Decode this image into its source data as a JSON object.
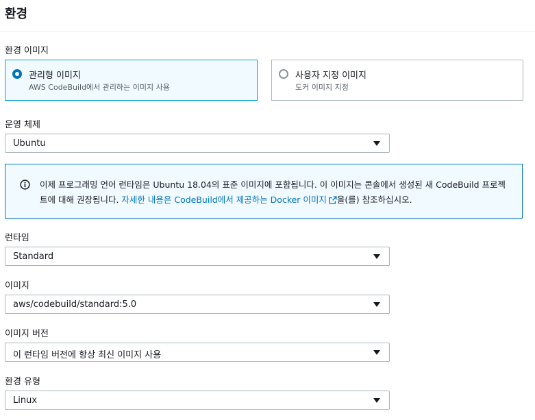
{
  "header": {
    "title": "환경"
  },
  "environment_image": {
    "label": "환경 이미지",
    "options": [
      {
        "title": "관리형 이미지",
        "description": "AWS CodeBuild에서 관리하는 이미지 사용",
        "selected": true
      },
      {
        "title": "사용자 지정 이미지",
        "description": "도커 이미지 지정",
        "selected": false
      }
    ]
  },
  "os": {
    "label": "운영 체제",
    "value": "Ubuntu"
  },
  "info": {
    "text_before": "이제 프로그래밍 언어 런타임은 Ubuntu 18.04의 표준 이미지에 포함됩니다. 이 이미지는 콘솔에서 생성된 새 CodeBuild 프로젝트에 대해 권장됩니다. ",
    "link_text": "자세한 내용은 CodeBuild에서 제공하는 Docker 이미지",
    "text_after": "을(를) 참조하십시오."
  },
  "runtime": {
    "label": "런타임",
    "value": "Standard"
  },
  "image": {
    "label": "이미지",
    "value": "aws/codebuild/standard:5.0"
  },
  "image_version": {
    "label": "이미지 버전",
    "value": "이 런타임 버전에 항상 최신 이미지 사용"
  },
  "environment_type": {
    "label": "환경 유형",
    "value": "Linux"
  },
  "colors": {
    "accent": "#0073bb",
    "selected_border": "#00a1c9",
    "info_bg": "#f1faff"
  },
  "icons": [
    "info-icon",
    "external-link-icon",
    "caret-down-icon"
  ]
}
